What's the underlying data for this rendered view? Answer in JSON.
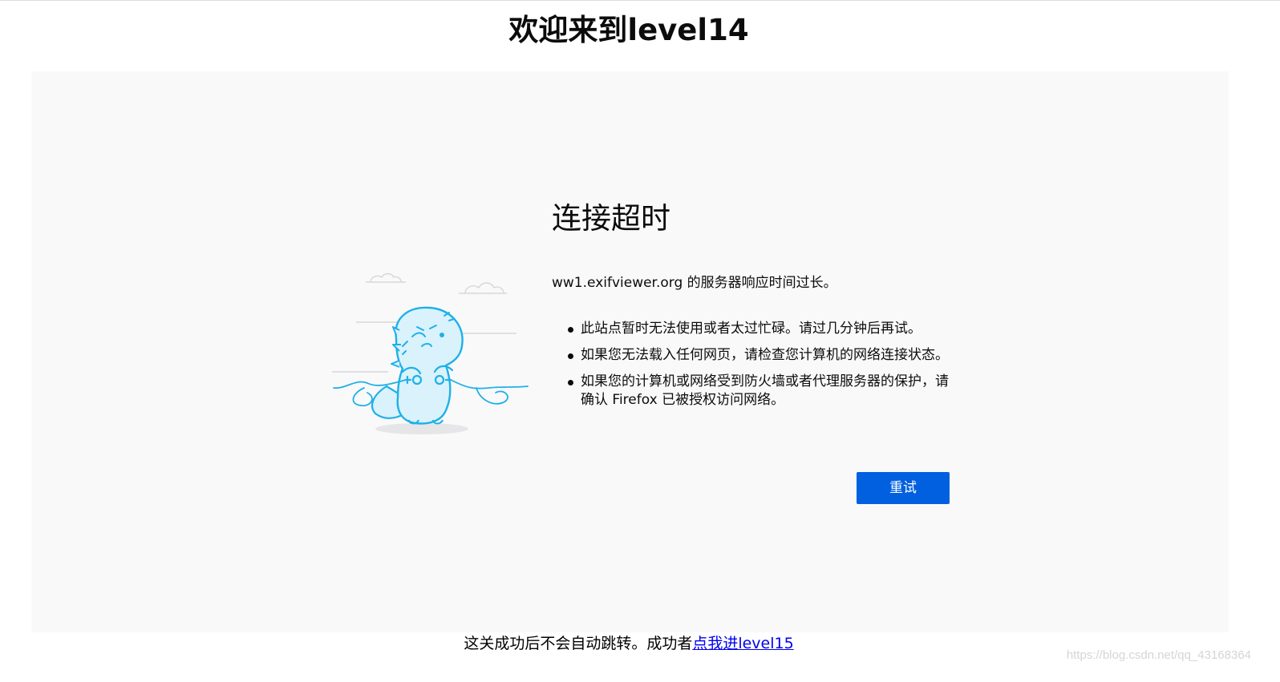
{
  "page": {
    "title": "欢迎来到level14"
  },
  "error": {
    "title": "连接超时",
    "description": "ww1.exifviewer.org 的服务器响应时间过长。",
    "suggestions": [
      "此站点暂时无法使用或者太过忙碌。请过几分钟后再试。",
      "如果您无法载入任何网页，请检查您计算机的网络连接状态。",
      "如果您的计算机或网络受到防火墙或者代理服务器的保护，请确认 Firefox 已被授权访问网络。"
    ],
    "retry_label": "重试",
    "illustration_icon": "disconnected-dinosaur-icon"
  },
  "footer": {
    "text": "这关成功后不会自动跳转。成功者",
    "link_label": "点我进level15"
  },
  "watermark": "https://blog.csdn.net/qq_43168364",
  "colors": {
    "accent": "#0060df",
    "frame_bg": "#f9f9fa",
    "illustration_stroke": "#1fb0e8",
    "illustration_fill": "#d9f2fc",
    "link": "#0000ee"
  }
}
